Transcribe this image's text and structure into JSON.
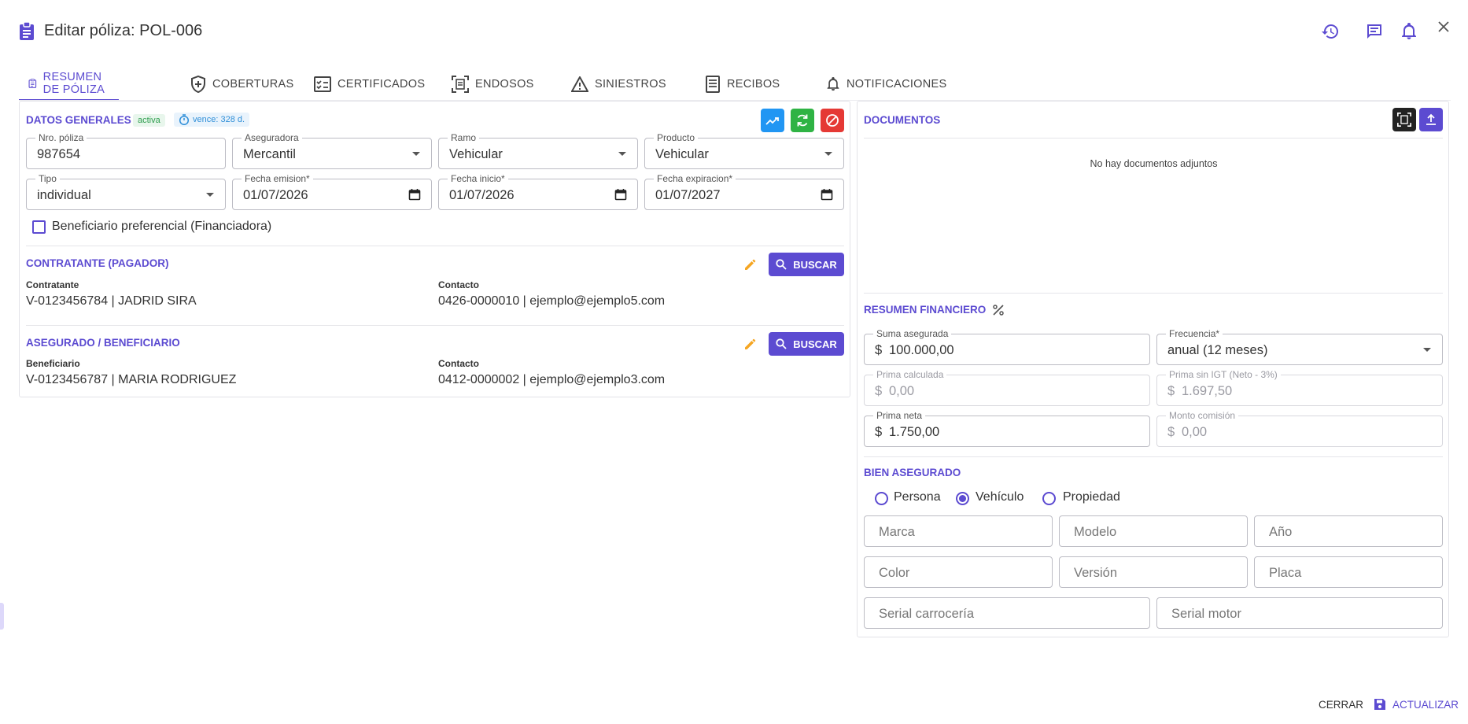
{
  "header": {
    "title": "Editar póliza: POL-006"
  },
  "tabs": [
    {
      "label": "RESUMEN DE PÓLIZA"
    },
    {
      "label": "COBERTURAS"
    },
    {
      "label": "CERTIFICADOS"
    },
    {
      "label": "ENDOSOS"
    },
    {
      "label": "SINIESTROS"
    },
    {
      "label": "RECIBOS"
    },
    {
      "label": "NOTIFICACIONES"
    }
  ],
  "general": {
    "title": "DATOS GENERALES",
    "status": "activa",
    "due": "vence: 328 d.",
    "fields": {
      "nro_poliza": {
        "label": "Nro. póliza",
        "value": "987654"
      },
      "aseguradora": {
        "label": "Aseguradora",
        "value": "Mercantil"
      },
      "ramo": {
        "label": "Ramo",
        "value": "Vehicular"
      },
      "producto": {
        "label": "Producto",
        "value": "Vehicular"
      },
      "tipo": {
        "label": "Tipo",
        "value": "individual"
      },
      "fecha_emision": {
        "label": "Fecha emision*",
        "value": "01/07/2026"
      },
      "fecha_inicio": {
        "label": "Fecha inicio*",
        "value": "01/07/2026"
      },
      "fecha_expiracion": {
        "label": "Fecha expiracion*",
        "value": "01/07/2027"
      }
    },
    "checkbox_label": "Beneficiario preferencial (Financiadora)"
  },
  "contratante": {
    "title": "CONTRATANTE (PAGADOR)",
    "button": "BUSCAR",
    "label1": "Contratante",
    "value1": "V-0123456784 | JADRID SIRA",
    "label2": "Contacto",
    "value2": "0426-0000010 | ejemplo@ejemplo5.com"
  },
  "asegurado": {
    "title": "ASEGURADO / BENEFICIARIO",
    "button": "BUSCAR",
    "label1": "Beneficiario",
    "value1": "V-0123456787 | MARIA RODRIGUEZ",
    "label2": "Contacto",
    "value2": "0412-0000002 | ejemplo@ejemplo3.com"
  },
  "documentos": {
    "title": "DOCUMENTOS",
    "empty": "No hay documentos adjuntos"
  },
  "financiero": {
    "title": "RESUMEN FINANCIERO",
    "currency": "$",
    "suma": {
      "label": "Suma asegurada",
      "value": "100.000,00"
    },
    "frecuencia": {
      "label": "Frecuencia*",
      "value": "anual (12 meses)"
    },
    "prima_calc": {
      "label": "Prima calculada",
      "value": "0,00"
    },
    "prima_sin_igt": {
      "label": "Prima sin IGT (Neto - 3%)",
      "value": "1.697,50"
    },
    "prima_neta": {
      "label": "Prima neta",
      "value": "1.750,00"
    },
    "comision": {
      "label": "Monto comisión",
      "value": "0,00"
    }
  },
  "bien": {
    "title": "BIEN ASEGURADO",
    "radios": [
      "Persona",
      "Vehículo",
      "Propiedad"
    ],
    "selected": "Vehículo",
    "placeholders": {
      "marca": "Marca",
      "modelo": "Modelo",
      "anio": "Año",
      "color": "Color",
      "version": "Versión",
      "placa": "Placa",
      "serial_carroceria": "Serial carrocería",
      "serial_motor": "Serial motor"
    }
  },
  "footer": {
    "cerrar": "CERRAR",
    "actualizar": "ACTUALIZAR"
  },
  "colors": {
    "accent": "#5c4bd1",
    "blue": "#2196f3",
    "green": "#2fb344",
    "red": "#e53935",
    "orange": "#f5a623"
  }
}
